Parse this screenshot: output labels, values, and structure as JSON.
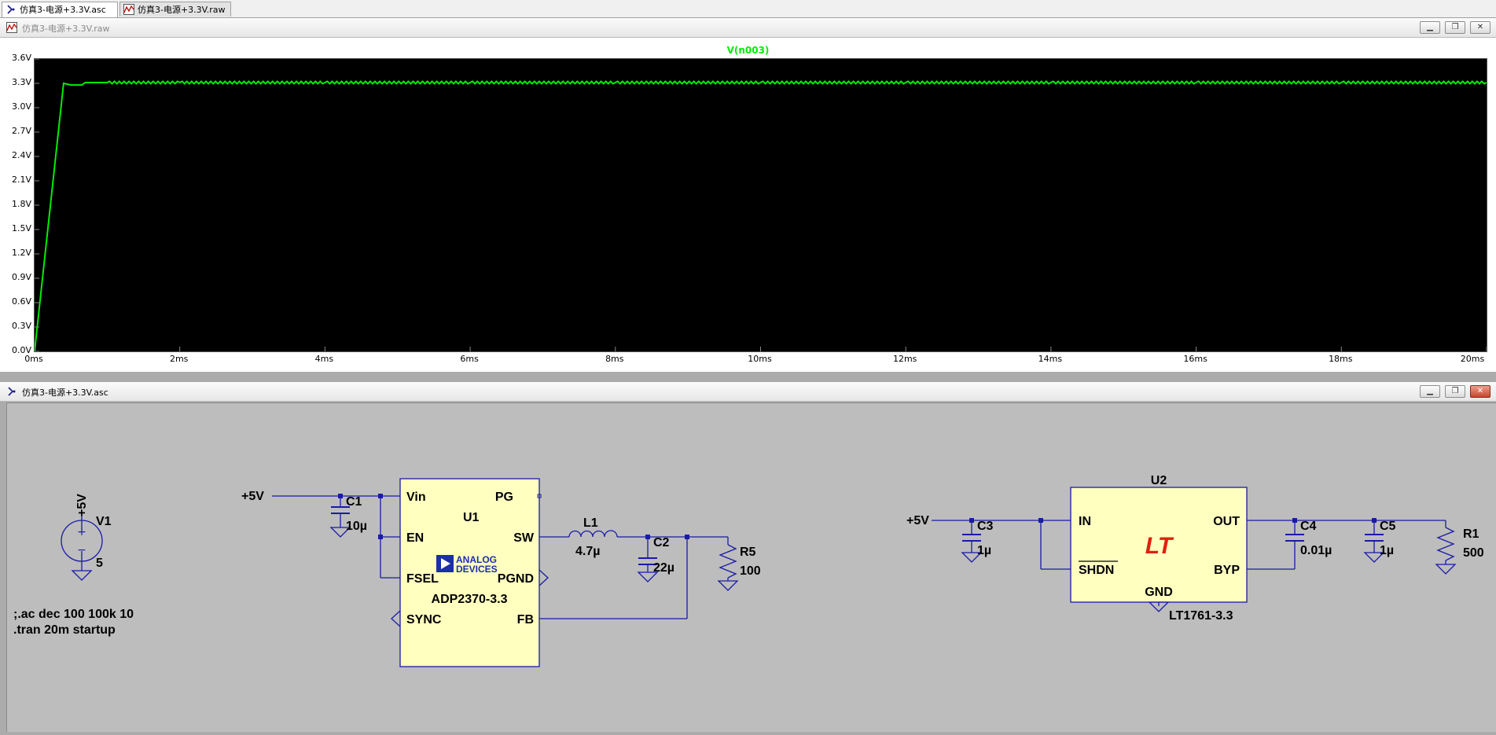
{
  "tabs": [
    {
      "label": "仿真3-电源+3.3V.asc",
      "active": true
    },
    {
      "label": "仿真3-电源+3.3V.raw",
      "active": false
    }
  ],
  "plot_window": {
    "title": "仿真3-电源+3.3V.raw",
    "trace_name": "V(n003)",
    "trace_color": "#00ee00",
    "controls": [
      "minimize",
      "restore",
      "close"
    ]
  },
  "chart_data": {
    "type": "line",
    "title": "V(n003)",
    "xlabel": "",
    "ylabel": "",
    "x_ticks": [
      "0ms",
      "2ms",
      "4ms",
      "6ms",
      "8ms",
      "10ms",
      "12ms",
      "14ms",
      "16ms",
      "18ms",
      "20ms"
    ],
    "y_ticks": [
      "0.0V",
      "0.3V",
      "0.6V",
      "0.9V",
      "1.2V",
      "1.5V",
      "1.8V",
      "2.1V",
      "2.4V",
      "2.7V",
      "3.0V",
      "3.3V",
      "3.6V"
    ],
    "xlim": [
      0,
      20
    ],
    "ylim": [
      0,
      3.6
    ],
    "series": [
      {
        "name": "V(n003)",
        "color": "#00ee00",
        "x": [
          0,
          0.4,
          0.5,
          0.65,
          0.7,
          1,
          2,
          4,
          6,
          8,
          10,
          12,
          14,
          16,
          18,
          20
        ],
        "y": [
          0,
          3.3,
          3.28,
          3.28,
          3.31,
          3.31,
          3.31,
          3.31,
          3.31,
          3.31,
          3.31,
          3.31,
          3.31,
          3.31,
          3.31,
          3.31
        ]
      }
    ]
  },
  "schematic_window": {
    "title": "仿真3-电源+3.3V.asc",
    "controls": [
      "minimize",
      "restore",
      "close"
    ]
  },
  "schematic": {
    "wire_color": "#1a1aa8",
    "body_color": "#ffffc0",
    "adi_color": "#1a2fa8",
    "lt_color": "#e02010",
    "v1": {
      "ref": "V1",
      "value": "5",
      "net": "+5V"
    },
    "directives": [
      ";.ac dec 100 100k 10",
      ".tran 20m startup"
    ],
    "u1": {
      "ref": "U1",
      "part": "ADP2370-3.3",
      "logo_line1": "ANALOG",
      "logo_line2": "DEVICES",
      "pins": {
        "vin": "Vin",
        "pg": "PG",
        "en": "EN",
        "sw": "SW",
        "fsel": "FSEL",
        "pgnd": "PGND",
        "sync": "SYNC",
        "fb": "FB"
      }
    },
    "u1_net": "+5V",
    "c1": {
      "ref": "C1",
      "value": "10µ"
    },
    "l1": {
      "ref": "L1",
      "value": "4.7µ"
    },
    "c2": {
      "ref": "C2",
      "value": "22µ"
    },
    "r5": {
      "ref": "R5",
      "value": "100"
    },
    "u2": {
      "ref": "U2",
      "part": "LT1761-3.3",
      "logo": "LT",
      "pins": {
        "in": "IN",
        "out": "OUT",
        "shdn": "SHDN",
        "byp": "BYP",
        "gnd": "GND"
      }
    },
    "u2_net": "+5V",
    "c3": {
      "ref": "C3",
      "value": "1µ"
    },
    "c4": {
      "ref": "C4",
      "value": "0.01µ"
    },
    "c5": {
      "ref": "C5",
      "value": "1µ"
    },
    "r1": {
      "ref": "R1",
      "value": "500"
    }
  }
}
